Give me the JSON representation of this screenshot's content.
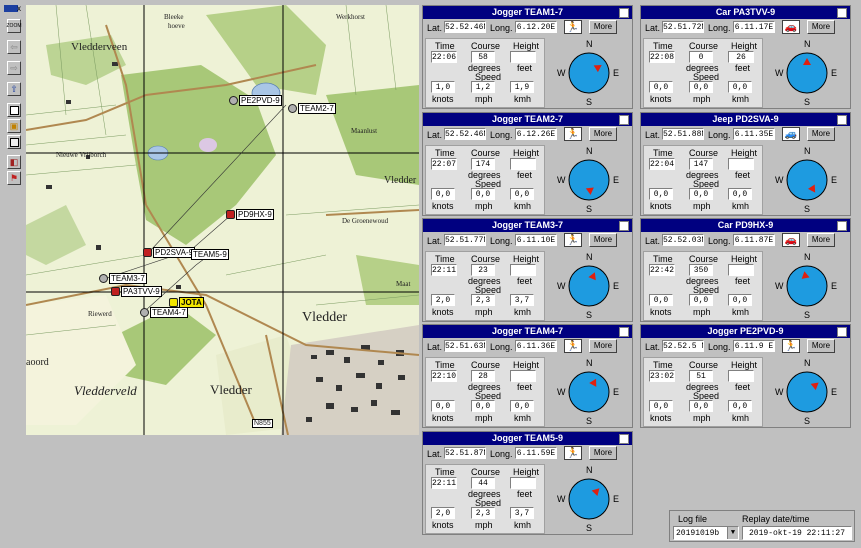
{
  "toolbar": {
    "zoom_label": "ZOOM",
    "close_glyph": "x"
  },
  "map": {
    "places": [
      "Vledderveen",
      "Vledder",
      "Vledderveld",
      "Vledder",
      "aoord",
      "Bleeke",
      "hoeve",
      "Werkhorst",
      "Vledder",
      "Nieuwe Vrijborch",
      "Riewerd",
      "De Groenewoud",
      "Maanlust",
      "Maat",
      "N855"
    ],
    "markers": {
      "pe2pvd": "PE2PVD-9",
      "team2": "TEAM2-7",
      "pd9hx": "PD9HX-9",
      "pd2sva": "PD2SVA-9",
      "team5": "TEAM5-9",
      "team3": "TEAM3-7",
      "pa3tvv": "PA3TVV-9",
      "jota": "JOTA",
      "team4": "TEAM4-7"
    }
  },
  "labels": {
    "lat": "Lat.",
    "long": "Long.",
    "more": "More",
    "time": "Time",
    "course": "Course",
    "height": "Height",
    "degrees": "degrees",
    "feet": "feet",
    "speed": "Speed",
    "knots": "knots",
    "mph": "mph",
    "kmh": "kmh",
    "n": "N",
    "e": "E",
    "s": "S",
    "w": "W"
  },
  "panels": [
    {
      "title": "Jogger TEAM1-7",
      "lat": "52.52.46N",
      "long": "6.12.20E",
      "time": "22:06",
      "course": "58",
      "height": "",
      "knots": "1,0",
      "mph": "1,2",
      "kmh": "1,9",
      "heading": 58,
      "icon": "runner-icon"
    },
    {
      "title": "Car PA3TVV-9",
      "lat": "52.51.72N",
      "long": "6.11.17E",
      "time": "22:08",
      "course": "0",
      "height": "26",
      "knots": "0,0",
      "mph": "0,0",
      "kmh": "0,0",
      "heading": 0,
      "icon": "car-icon"
    },
    {
      "title": "Jogger TEAM2-7",
      "lat": "52.52.46N",
      "long": "6.12.26E",
      "time": "22:07",
      "course": "174",
      "height": "",
      "knots": "0,0",
      "mph": "0,0",
      "kmh": "0,0",
      "heading": 174,
      "icon": "runner-icon"
    },
    {
      "title": "Jeep PD2SVA-9",
      "lat": "52.51.88N",
      "long": "6.11.35E",
      "time": "22:04",
      "course": "147",
      "height": "",
      "knots": "0,0",
      "mph": "0,0",
      "kmh": "0,0",
      "heading": 147,
      "icon": "jeep-icon"
    },
    {
      "title": "Jogger TEAM3-7",
      "lat": "52.51.77N",
      "long": "6.11.10E",
      "time": "22:11",
      "course": "23",
      "height": "",
      "knots": "2,0",
      "mph": "2,3",
      "kmh": "3,7",
      "heading": 23,
      "icon": "runner-icon"
    },
    {
      "title": "Car PD9HX-9",
      "lat": "52.52.03N",
      "long": "6.11.87E",
      "time": "22:42",
      "course": "350",
      "height": "",
      "knots": "0,0",
      "mph": "0,0",
      "kmh": "0,0",
      "heading": 350,
      "icon": "car-icon"
    },
    {
      "title": "Jogger TEAM4-7",
      "lat": "52.51.63N",
      "long": "6.11.36E",
      "time": "22:10",
      "course": "28",
      "height": "",
      "knots": "0,0",
      "mph": "0,0",
      "kmh": "0,0",
      "heading": 28,
      "icon": "runner-icon"
    },
    {
      "title": "Jogger PE2PVD-9",
      "lat": "52.52.5 N",
      "long": "6.11.9 E",
      "time": "23:02",
      "course": "51",
      "height": "",
      "knots": "0,0",
      "mph": "0,0",
      "kmh": "0,0",
      "heading": 51,
      "icon": "runner-icon"
    },
    {
      "title": "Jogger TEAM5-9",
      "lat": "52.51.87N",
      "long": "6.11.59E",
      "time": "22:11",
      "course": "44",
      "height": "",
      "knots": "2,0",
      "mph": "2,3",
      "kmh": "3,7",
      "heading": 44,
      "icon": "runner-icon"
    }
  ],
  "log": {
    "log_file_label": "Log file",
    "log_file_value": "20191019b",
    "replay_label": "Replay date/time",
    "replay_value": "2019-okt-19 22:11:27"
  },
  "colors": {
    "title_bar": "#000080",
    "compass_fill": "#1e9be0",
    "arrow": "#e02010"
  }
}
